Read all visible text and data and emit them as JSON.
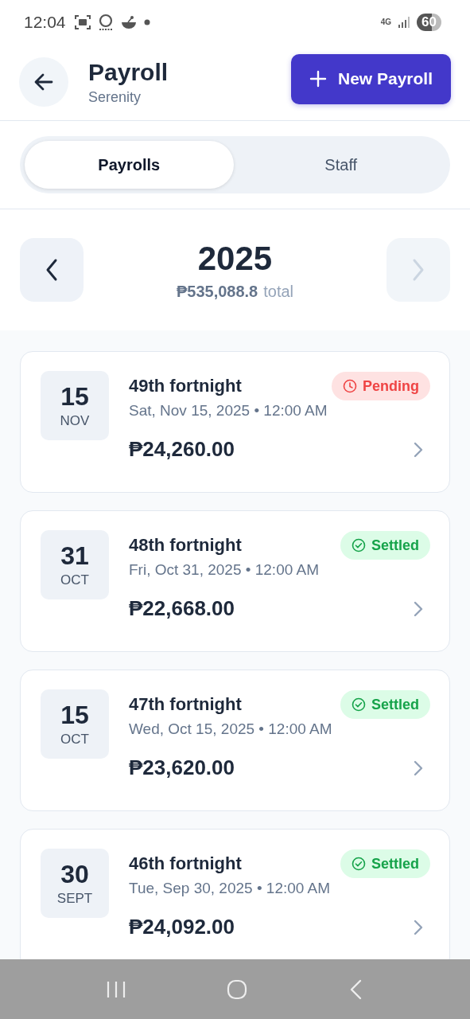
{
  "status_bar": {
    "time": "12:04",
    "network": "4G",
    "battery": "60"
  },
  "header": {
    "title": "Payroll",
    "subtitle": "Serenity",
    "action": "New Payroll"
  },
  "tabs": [
    {
      "label": "Payrolls",
      "selected": true
    },
    {
      "label": "Staff",
      "selected": false
    }
  ],
  "year_nav": {
    "year": "2025",
    "total": "₱535,088.8",
    "total_label": "total",
    "prev_disabled": false,
    "next_disabled": true
  },
  "payrolls": [
    {
      "day": "15",
      "month": "NOV",
      "title": "49th fortnight",
      "date": "Sat, Nov 15, 2025 • 12:00 AM",
      "amount": "₱24,260.00",
      "status": {
        "kind": "pending",
        "label": "Pending"
      }
    },
    {
      "day": "31",
      "month": "OCT",
      "title": "48th fortnight",
      "date": "Fri, Oct 31, 2025 • 12:00 AM",
      "amount": "₱22,668.00",
      "status": {
        "kind": "settled",
        "label": "Settled"
      }
    },
    {
      "day": "15",
      "month": "OCT",
      "title": "47th fortnight",
      "date": "Wed, Oct 15, 2025 • 12:00 AM",
      "amount": "₱23,620.00",
      "status": {
        "kind": "settled",
        "label": "Settled"
      }
    },
    {
      "day": "30",
      "month": "SEPT",
      "title": "46th fortnight",
      "date": "Tue, Sep 30, 2025 • 12:00 AM",
      "amount": "₱24,092.00",
      "status": {
        "kind": "settled",
        "label": "Settled"
      }
    }
  ]
}
